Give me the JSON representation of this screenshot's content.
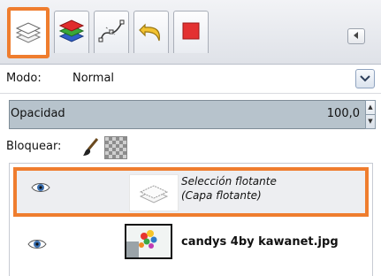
{
  "tabs": [
    {
      "icon": "layers-icon",
      "active": true
    },
    {
      "icon": "channels-icon",
      "active": false
    },
    {
      "icon": "paths-icon",
      "active": false
    },
    {
      "icon": "undo-history-icon",
      "active": false
    },
    {
      "icon": "stop-square-icon",
      "active": false
    }
  ],
  "mode": {
    "label": "Modo:",
    "value": "Normal"
  },
  "opacity": {
    "label": "Opacidad",
    "value": "100,0"
  },
  "lock": {
    "label": "Bloquear:"
  },
  "layers": [
    {
      "name_line1": "Selección flotante",
      "name_line2": "(Capa flotante)",
      "visible": true,
      "selected": true
    },
    {
      "name": "candys  4by kawanet.jpg",
      "visible": true,
      "selected": false
    }
  ],
  "colors": {
    "highlight": "#ef7d2e",
    "opacity_bar": "#b7c3cc"
  }
}
